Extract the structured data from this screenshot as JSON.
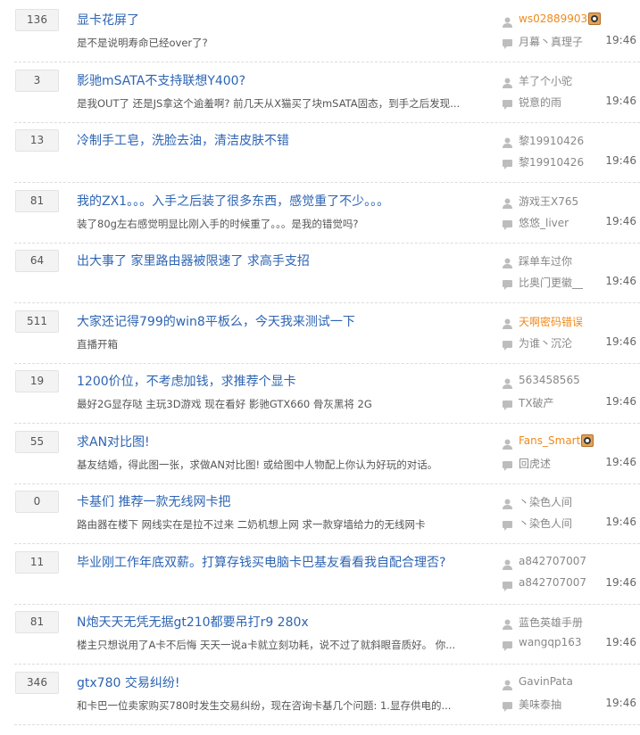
{
  "threads": [
    {
      "replies": "136",
      "title": "显卡花屏了",
      "excerpt": "是不是说明寿命已经over了?",
      "author": "ws02889903",
      "author_highlight": true,
      "author_badge": true,
      "last_reply": "月幕丶真理子",
      "time": "19:46"
    },
    {
      "replies": "3",
      "title": "影驰mSATA不支持联想Y400?",
      "excerpt": "是我OUT了 还是JS拿这个逾羞啊? 前几天从X猫买了块mSATA固态，到手之后发现...",
      "author": "羊了个小驼",
      "author_highlight": false,
      "author_badge": false,
      "last_reply": "锐意的雨",
      "time": "19:46"
    },
    {
      "replies": "13",
      "title": "冷制手工皂，洗脸去油，清洁皮肤不错",
      "excerpt": "",
      "author": "黎19910426",
      "author_highlight": false,
      "author_badge": false,
      "last_reply": "黎19910426",
      "time": "19:46"
    },
    {
      "replies": "81",
      "title": "我的ZX1。。。入手之后装了很多东西，感觉重了不少。。。",
      "excerpt": "装了80g左右感觉明显比刚入手的时候重了。。。是我的错觉吗?",
      "author": "游戏王X765",
      "author_highlight": false,
      "author_badge": false,
      "last_reply": "悠悠_liver",
      "time": "19:46"
    },
    {
      "replies": "64",
      "title": "出大事了 家里路由器被限速了 求高手支招",
      "excerpt": "",
      "author": "踩单车过你",
      "author_highlight": false,
      "author_badge": false,
      "last_reply": "比奥门更徽__",
      "time": "19:46"
    },
    {
      "replies": "511",
      "title": "大家还记得799的win8平板么，今天我来测试一下",
      "excerpt": "直播开箱",
      "author": "天啊密码错误",
      "author_highlight": true,
      "author_badge": false,
      "last_reply": "为谁丶沉沦",
      "time": "19:46"
    },
    {
      "replies": "19",
      "title": "1200价位，不考虑加钱，求推荐个显卡",
      "excerpt": "最好2G显存哒 主玩3D游戏 现在看好 影驰GTX660 骨灰黑将 2G",
      "author": "563458565",
      "author_highlight": false,
      "author_badge": false,
      "last_reply": "TX破产",
      "time": "19:46"
    },
    {
      "replies": "55",
      "title": "求AN对比图!",
      "excerpt": "基友结婚，得此图一张，求做AN对比图! 或给图中人物配上你认为好玩的对话。",
      "author": "Fans_Smart",
      "author_highlight": true,
      "author_badge": true,
      "last_reply": "回虎述",
      "time": "19:46"
    },
    {
      "replies": "0",
      "title": "卡基们 推荐一款无线网卡把",
      "excerpt": "路由器在楼下 网线实在是拉不过来 二奶机想上网 求一款穿墙给力的无线网卡",
      "author": "丶染色人间",
      "author_highlight": false,
      "author_badge": false,
      "last_reply": "丶染色人间",
      "time": "19:46"
    },
    {
      "replies": "11",
      "title": "毕业刚工作年底双薪。打算存钱买电脑卡巴基友看看我自配合理否?",
      "excerpt": "",
      "author": "a842707007",
      "author_highlight": false,
      "author_badge": false,
      "last_reply": "a842707007",
      "time": "19:46"
    },
    {
      "replies": "81",
      "title": "N炮天天无凭无据gt210都要吊打r9 280x",
      "excerpt": "楼主只想说用了A卡不后悔 天天一说a卡就立刻功耗，说不过了就斜眼音质好。 你...",
      "author": "蓝色英雄手册",
      "author_highlight": false,
      "author_badge": false,
      "last_reply": "wangqp163",
      "time": "19:46"
    },
    {
      "replies": "346",
      "title": "gtx780 交易纠纷!",
      "excerpt": "和卡巴一位卖家购买780时发生交易纠纷，现在咨询卡基几个问题: 1.显存供电的...",
      "author": "GavinPata",
      "author_highlight": false,
      "author_badge": false,
      "last_reply": "美味泰抽",
      "time": "19:46"
    }
  ]
}
